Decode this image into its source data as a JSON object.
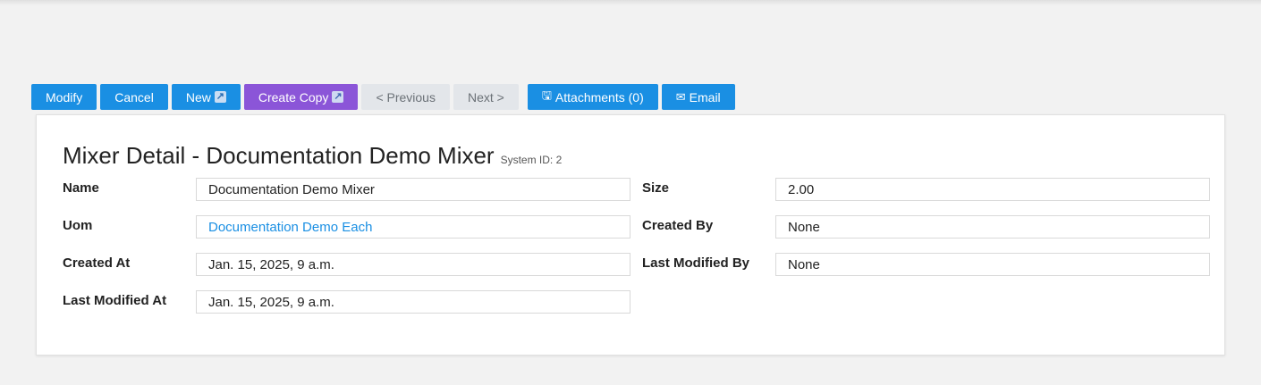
{
  "toolbar": {
    "modify_label": "Modify",
    "cancel_label": "Cancel",
    "new_label": "New",
    "new_icon": "external-link-icon",
    "create_copy_label": "Create Copy",
    "create_copy_icon": "external-link-icon",
    "previous_label": "< Previous",
    "next_label": "Next >",
    "attachments_label": "Attachments (0)",
    "attachments_icon": "floppy-disk-icon",
    "email_label": "Email",
    "email_icon": "envelope-icon"
  },
  "colors": {
    "primary": "#1a8fe3",
    "purple": "#8b55d8",
    "disabled": "#e3e6ea",
    "background": "#f2f2f2"
  },
  "detail": {
    "title": "Mixer Detail - Documentation Demo Mixer",
    "system_id": "System ID: 2",
    "fields": {
      "name": {
        "label": "Name",
        "value": "Documentation Demo Mixer"
      },
      "size": {
        "label": "Size",
        "value": "2.00"
      },
      "uom": {
        "label": "Uom",
        "value": "Documentation Demo Each"
      },
      "created_by": {
        "label": "Created By",
        "value": "None"
      },
      "created_at": {
        "label": "Created At",
        "value": "Jan. 15, 2025, 9 a.m."
      },
      "last_modified_by": {
        "label": "Last Modified By",
        "value": "None"
      },
      "last_modified_at": {
        "label": "Last Modified At",
        "value": "Jan. 15, 2025, 9 a.m."
      }
    }
  }
}
